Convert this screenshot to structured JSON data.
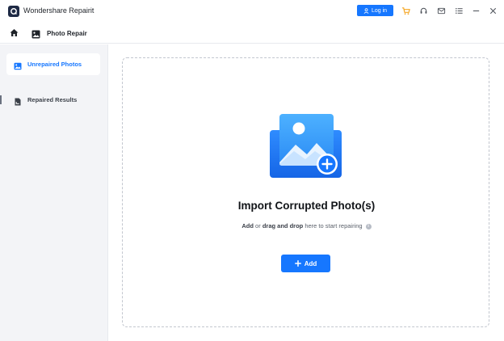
{
  "titlebar": {
    "app_title": "Wondershare Repairit",
    "login_label": "Log in",
    "icons": [
      "cart-icon",
      "headset-icon",
      "mail-icon",
      "menu-icon",
      "minimize-icon",
      "close-icon"
    ]
  },
  "navbar": {
    "title": "Photo Repair"
  },
  "sidebar": {
    "items": [
      {
        "label": "Unrepaired Photos",
        "active": true
      },
      {
        "label": "Repaired Results",
        "active": false
      }
    ]
  },
  "main": {
    "title": "Import Corrupted Photo(s)",
    "sub_add": "Add",
    "sub_or": " or ",
    "sub_drag": "drag and drop",
    "sub_rest": " here to start repairing",
    "add_button": "Add"
  },
  "colors": {
    "accent": "#1677ff",
    "cart": "#f5a623"
  }
}
